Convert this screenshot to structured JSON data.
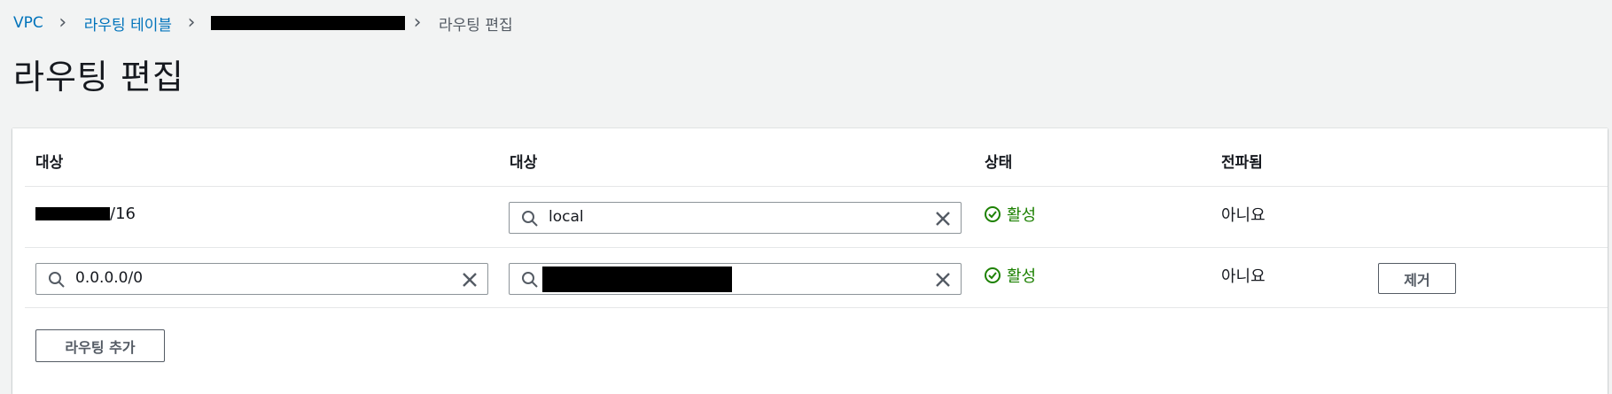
{
  "breadcrumb": {
    "vpc": "VPC",
    "route_tables": "라우팅 테이블",
    "current": "라우팅 편집"
  },
  "page_title": "라우팅 편집",
  "table": {
    "headers": {
      "destination": "대상",
      "target": "대상",
      "status": "상태",
      "propagated": "전파됨"
    },
    "rows": [
      {
        "destination_suffix": "/16",
        "target_value": "local",
        "status": "활성",
        "propagated": "아니요"
      },
      {
        "destination_value": "0.0.0.0/0",
        "status": "활성",
        "propagated": "아니요",
        "remove_label": "제거"
      }
    ]
  },
  "add_route_label": "라우팅 추가",
  "colors": {
    "link": "#0073bb",
    "success": "#1d8102",
    "page_bg": "#f2f3f3"
  }
}
